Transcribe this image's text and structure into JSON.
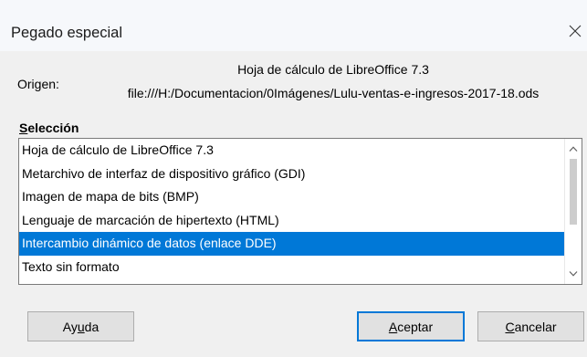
{
  "dialog": {
    "title": "Pegado especial"
  },
  "origin": {
    "label": "Origen:",
    "source_app": "Hoja de cálculo de LibreOffice 7.3",
    "source_path": "file:///H:/Documentacion/0Imágenes/Lulu-ventas-e-ingresos-2017-18.ods"
  },
  "selection": {
    "label_mnemonic": "S",
    "label_rest": "elección",
    "items": [
      "Hoja de cálculo de LibreOffice 7.3",
      "Metarchivo de interfaz de dispositivo gráfico (GDI)",
      "Imagen de mapa de bits (BMP)",
      "Lenguaje de marcación de hipertexto (HTML)",
      "Intercambio dinámico de datos (enlace DDE)",
      "Texto sin formato"
    ],
    "selected_index": 4
  },
  "buttons": {
    "help": {
      "pre": "Ay",
      "mnemonic": "u",
      "post": "da"
    },
    "accept": {
      "pre": "",
      "mnemonic": "A",
      "post": "ceptar"
    },
    "cancel": {
      "pre": "",
      "mnemonic": "C",
      "post": "ancelar"
    }
  },
  "icons": {
    "close": "close-icon",
    "scroll_up": "chevron-up-icon",
    "scroll_down": "chevron-down-icon"
  },
  "colors": {
    "selection_bg": "#0078d7",
    "selection_fg": "#ffffff",
    "dialog_bg": "#f0f0f0",
    "titlebar_bg": "#f6f8fb"
  }
}
